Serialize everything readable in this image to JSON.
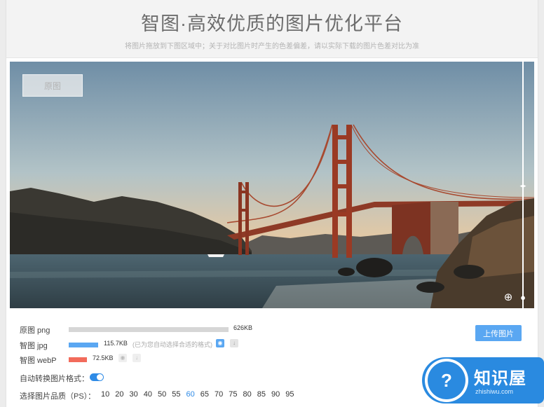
{
  "header": {
    "title": "智图·高效优质的图片优化平台",
    "subtitle": "将图片拖放到下图区域中；关于对比图片时产生的色差偏差，请以实际下载的图片色差对比为准"
  },
  "preview": {
    "original_tag": "原图"
  },
  "results": [
    {
      "label": "原图 png",
      "size": "626KB",
      "ratio": 1.0,
      "color": "#d6d6d6"
    },
    {
      "label": "智图 jpg",
      "size": "115.7KB",
      "hint": "(已为您自动选择合适的格式)",
      "ratio": 0.185,
      "color": "#5aa7f2"
    },
    {
      "label": "智图 webP",
      "size": "72.5KB",
      "ratio": 0.116,
      "color": "#f26b5b"
    }
  ],
  "upload_button": "上传图片",
  "auto_convert_label": "自动转换图片格式：",
  "auto_convert_on": true,
  "quality": {
    "label": "选择图片品质（PS）：",
    "options": [
      "10",
      "20",
      "30",
      "40",
      "50",
      "55",
      "60",
      "65",
      "70",
      "75",
      "80",
      "85",
      "90",
      "95"
    ],
    "selected": "60"
  },
  "logo": {
    "title": "知识屋",
    "url": "zhishiwu.com"
  }
}
